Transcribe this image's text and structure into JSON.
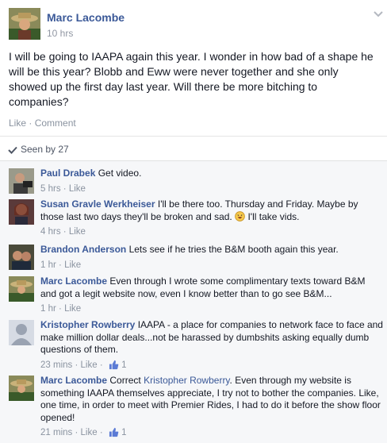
{
  "post": {
    "author": "Marc Lacombe",
    "time": "10 hrs",
    "text": "I will be going to IAAPA again this year. I wonder in how bad of a shape he will be this year? Blobb and Eww were never together and she only showed up the first day last year. Will there be more bitching to companies?",
    "like_label": "Like",
    "comment_label": "Comment",
    "separator": " · "
  },
  "seen": {
    "label": "Seen by 27"
  },
  "comments": [
    {
      "name": "Paul Drabek",
      "text": "Get video.",
      "time": "5 hrs",
      "like_label": "Like"
    },
    {
      "name": "Susan Gravle Werkheiser",
      "text": "I'll be there too. Thursday and Friday. Maybe by those last two days they'll be broken and sad.",
      "text_after_emoji": "I'll take vids.",
      "time": "4 hrs",
      "like_label": "Like"
    },
    {
      "name": "Brandon Anderson",
      "text": "Lets see if he tries the B&M booth again this year.",
      "time": "1 hr",
      "like_label": "Like"
    },
    {
      "name": "Marc Lacombe",
      "text": "Even through I wrote some complimentary texts toward B&M and got a legit website now, even I know better than to go see B&M...",
      "time": "1 hr",
      "like_label": "Like"
    },
    {
      "name": "Kristopher Rowberry",
      "text": "IAAPA - a place for companies to network face to face and make million dollar deals...not be harassed by dumbshits asking equally dumb questions of them.",
      "time": "23 mins",
      "like_label": "Like",
      "likes": "1"
    },
    {
      "name": "Marc Lacombe",
      "text_before_tag": "Correct",
      "tag": "Kristopher Rowberry",
      "text": ". Even through my website is something IAAPA themselves appreciate, I try not to bother the companies. Like, one time, in order to meet with Premier Rides, I had to do it before the show floor opened!",
      "time": "21 mins",
      "like_label": "Like",
      "likes": "1"
    }
  ],
  "colors": {
    "link": "#3b5998",
    "meta": "#8a93a0",
    "comments_bg": "#f6f7f9"
  }
}
